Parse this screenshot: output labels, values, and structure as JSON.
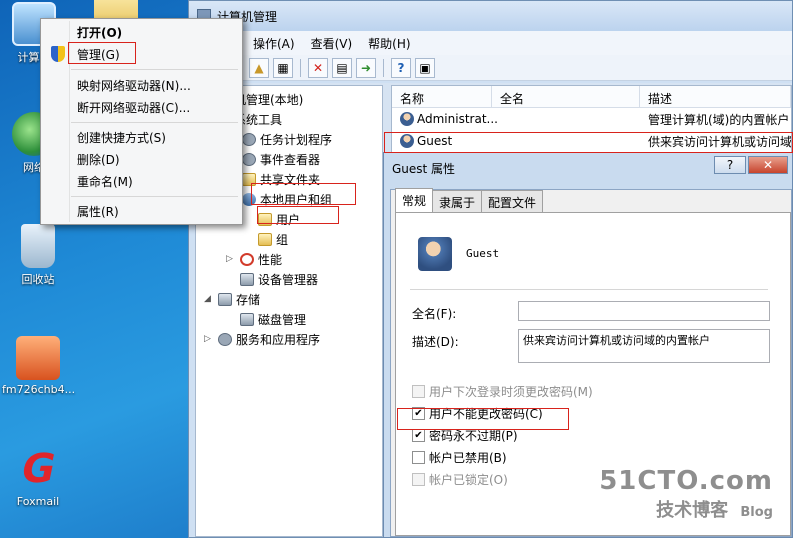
{
  "desktop": {
    "icons": [
      {
        "label": "计算机"
      },
      {
        "label": "网络"
      },
      {
        "label": "回收站"
      },
      {
        "label": "fm726chb4..."
      },
      {
        "label": "Foxmail"
      }
    ]
  },
  "window": {
    "title": "计算机管理",
    "menu": [
      "操作(A)",
      "查看(V)",
      "帮助(H)"
    ]
  },
  "tree": {
    "items": [
      "机管理(本地)",
      "系统工具",
      "任务计划程序",
      "事件查看器",
      "共享文件夹",
      "本地用户和组",
      "用户",
      "组",
      "性能",
      "设备管理器",
      "存储",
      "磁盘管理",
      "服务和应用程序"
    ]
  },
  "list": {
    "columns": [
      "名称",
      "全名",
      "描述"
    ],
    "rows": [
      {
        "name": "Administrat...",
        "fullname": "",
        "desc": "管理计算机(域)的内置帐户"
      },
      {
        "name": "Guest",
        "fullname": "",
        "desc": "供来宾访问计算机或访问域"
      }
    ]
  },
  "context_menu": {
    "items": [
      "打开(O)",
      "管理(G)",
      "映射网络驱动器(N)...",
      "断开网络驱动器(C)...",
      "创建快捷方式(S)",
      "删除(D)",
      "重命名(M)",
      "属性(R)"
    ]
  },
  "dialog": {
    "title": "Guest 属性",
    "help_btn": "?",
    "close_btn": "✕",
    "tabs": [
      "常规",
      "隶属于",
      "配置文件"
    ],
    "username": "Guest",
    "fullname_label": "全名(F):",
    "fullname_value": "",
    "desc_label": "描述(D):",
    "desc_value": "供来宾访问计算机或访问域的内置帐户",
    "checks": [
      {
        "label": "用户下次登录时须更改密码(M)",
        "checked": false,
        "disabled": true
      },
      {
        "label": "用户不能更改密码(C)",
        "checked": true,
        "disabled": false
      },
      {
        "label": "密码永不过期(P)",
        "checked": true,
        "disabled": false
      },
      {
        "label": "帐户已禁用(B)",
        "checked": false,
        "disabled": false
      },
      {
        "label": "帐户已锁定(O)",
        "checked": false,
        "disabled": true
      }
    ]
  },
  "watermark": {
    "top": "51CTO.com",
    "bottom": "技术博客",
    "blog": "Blog"
  }
}
